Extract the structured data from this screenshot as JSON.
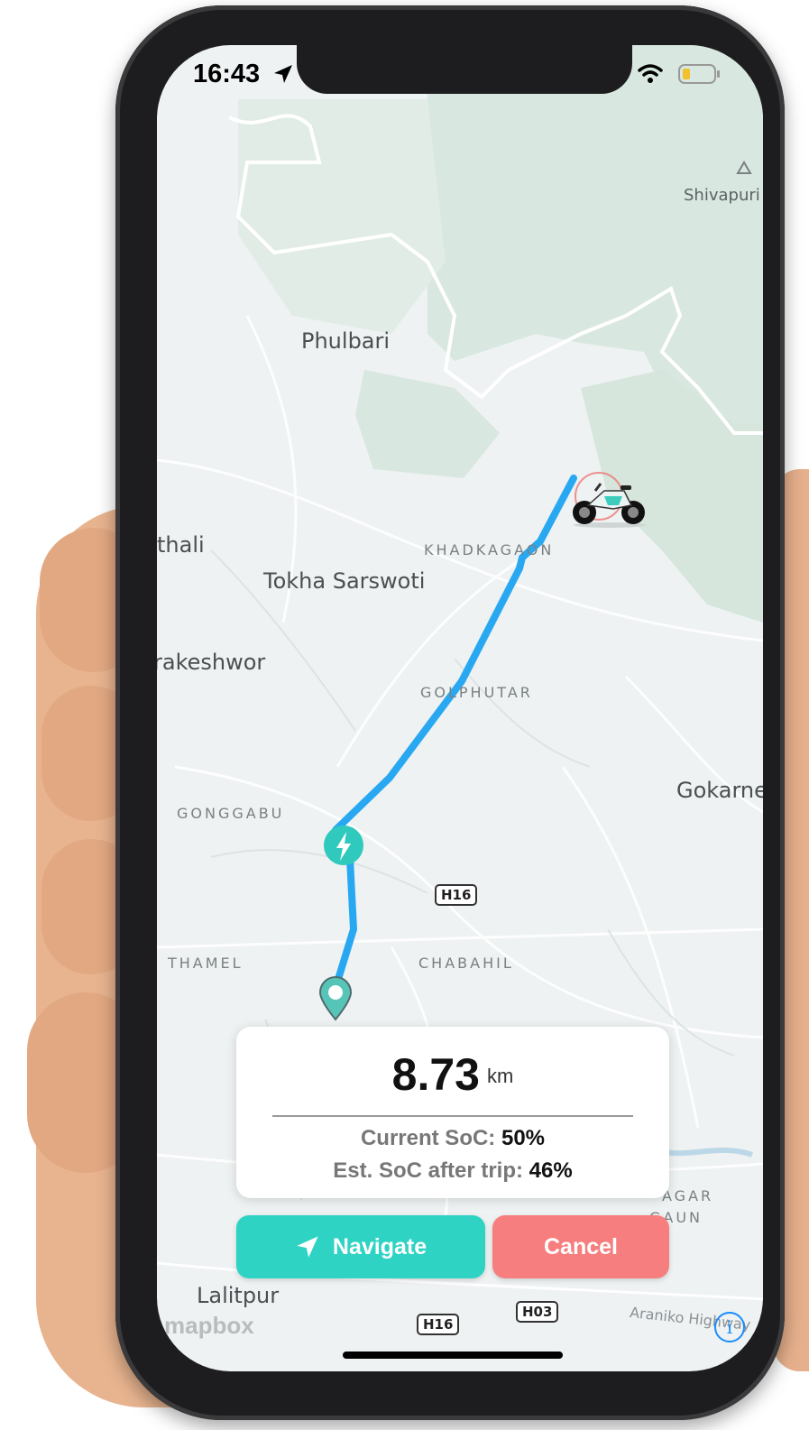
{
  "status_bar": {
    "time": "16:43"
  },
  "map": {
    "labels": {
      "shivapuri": "Shivapuri",
      "phulbari": "Phulbari",
      "thali": "thali",
      "khadka_gaon": "KHADKAGAON",
      "tokha": "Tokha Sarswoti",
      "rakeshwor": "rakeshwor",
      "golphutar": "GOLPHUTAR",
      "gokarna": "Gokarne",
      "gonggabu": "GONGGABU",
      "thamel": "THAMEL",
      "chabahil": "CHABAHIL",
      "nagar_gaun_1": "AGAR",
      "nagar_gaun_2": "GAUN",
      "lalitpur": "Lalitpur",
      "araniko": "Araniko Highway"
    },
    "road_shields": {
      "h16_top": "H16",
      "h16_bottom": "H16",
      "h03": "H03"
    },
    "attribution": "mapbox",
    "route_color": "#29a8f2"
  },
  "trip_card": {
    "distance": "8.73",
    "distance_unit": "km",
    "current_soc_label": "Current SoC:",
    "current_soc_value": "50%",
    "est_soc_label": "Est. SoC after trip:",
    "est_soc_value": "46%"
  },
  "actions": {
    "navigate_label": "Navigate",
    "cancel_label": "Cancel"
  },
  "colors": {
    "navigate": "#2fd3c4",
    "cancel": "#f77e7e",
    "charger": "#2fc9bd"
  },
  "icons": [
    "location-arrow-icon",
    "wifi-icon",
    "battery-icon",
    "charging-station-icon",
    "destination-pin-icon",
    "motorcycle-icon",
    "navigate-arrow-icon",
    "info-icon"
  ]
}
